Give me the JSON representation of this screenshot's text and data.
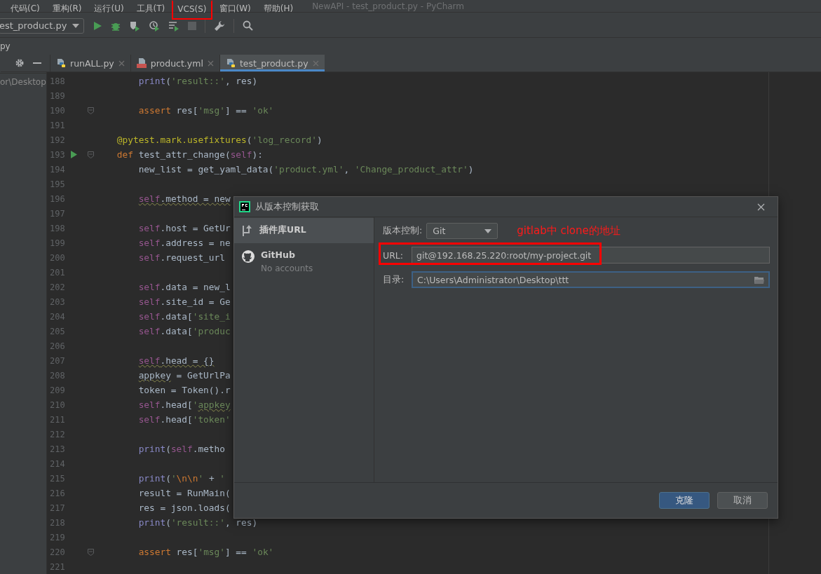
{
  "menu_bar": {
    "items": [
      {
        "label": "代码(C)",
        "highlighted": false
      },
      {
        "label": "重构(R)",
        "highlighted": false
      },
      {
        "label": "运行(U)",
        "highlighted": false
      },
      {
        "label": "工具(T)",
        "highlighted": false
      },
      {
        "label": "VCS(S)",
        "highlighted": true
      },
      {
        "label": "窗口(W)",
        "highlighted": false
      },
      {
        "label": "帮助(H)",
        "highlighted": false
      }
    ],
    "window_title": "NewAPI - test_product.py - PyCharm"
  },
  "toolbar": {
    "run_config": "est_product.py"
  },
  "breadcrumb": "py",
  "project_panel": {
    "path": "or\\Desktop"
  },
  "tabs": [
    {
      "label": "runALL.py",
      "kind": "python",
      "selected": false
    },
    {
      "label": "product.yml",
      "kind": "yaml",
      "selected": false
    },
    {
      "label": "test_product.py",
      "kind": "python",
      "selected": true
    }
  ],
  "editor": {
    "lines": [
      {
        "number": "188",
        "run_marker": false,
        "foldable": false,
        "tokens": [
          {
            "t": "        print",
            "kind": "builtin"
          },
          {
            "t": "(",
            "kind": "plain"
          },
          {
            "t": "'result::'",
            "kind": "string"
          },
          {
            "t": ", res)",
            "kind": "plain"
          }
        ]
      },
      {
        "number": "189",
        "run_marker": false,
        "foldable": false
      },
      {
        "number": "190",
        "run_marker": false,
        "foldable": true,
        "tokens": [
          {
            "t": "        assert",
            "kind": "keyword"
          },
          {
            "t": " res[",
            "kind": "plain"
          },
          {
            "t": "'msg'",
            "kind": "string"
          },
          {
            "t": "] == ",
            "kind": "plain"
          },
          {
            "t": "'ok'",
            "kind": "string"
          }
        ]
      },
      {
        "number": "191",
        "run_marker": false,
        "foldable": false
      },
      {
        "number": "192",
        "run_marker": false,
        "foldable": false,
        "tokens": [
          {
            "t": "    @pytest.mark.usefixtures",
            "kind": "decorator"
          },
          {
            "t": "(",
            "kind": "plain"
          },
          {
            "t": "'log_record'",
            "kind": "string"
          },
          {
            "t": ")",
            "kind": "plain"
          }
        ]
      },
      {
        "number": "193",
        "run_marker": true,
        "foldable": true,
        "tokens": [
          {
            "t": "    def",
            "kind": "keyword"
          },
          {
            "t": " test_attr_change(",
            "kind": "plain"
          },
          {
            "t": "self",
            "kind": "self"
          },
          {
            "t": "):",
            "kind": "plain"
          }
        ]
      },
      {
        "number": "194",
        "run_marker": false,
        "foldable": false,
        "tokens": [
          {
            "t": "        new_list = get_yaml_data(",
            "kind": "plain"
          },
          {
            "t": "'product.yml'",
            "kind": "string"
          },
          {
            "t": ", ",
            "kind": "plain"
          },
          {
            "t": "'Change_product_attr'",
            "kind": "string"
          },
          {
            "t": ")",
            "kind": "plain"
          }
        ]
      },
      {
        "number": "195",
        "run_marker": false,
        "foldable": false
      },
      {
        "number": "196",
        "run_marker": false,
        "foldable": false,
        "tokens": [
          {
            "t": "        self",
            "kind": "self",
            "squiggly": true
          },
          {
            "t": ".method = new",
            "kind": "plain",
            "squiggly": true
          }
        ]
      },
      {
        "number": "197",
        "run_marker": false,
        "foldable": false
      },
      {
        "number": "198",
        "run_marker": false,
        "foldable": false,
        "tokens": [
          {
            "t": "        self",
            "kind": "self"
          },
          {
            "t": ".host = GetUr",
            "kind": "plain"
          }
        ]
      },
      {
        "number": "199",
        "run_marker": false,
        "foldable": false,
        "tokens": [
          {
            "t": "        self",
            "kind": "self"
          },
          {
            "t": ".address = ne",
            "kind": "plain"
          }
        ]
      },
      {
        "number": "200",
        "run_marker": false,
        "foldable": false,
        "tokens": [
          {
            "t": "        self",
            "kind": "self"
          },
          {
            "t": ".request_url",
            "kind": "plain"
          }
        ]
      },
      {
        "number": "201",
        "run_marker": false,
        "foldable": false
      },
      {
        "number": "202",
        "run_marker": false,
        "foldable": false,
        "tokens": [
          {
            "t": "        self",
            "kind": "self"
          },
          {
            "t": ".data = new_l",
            "kind": "plain"
          }
        ]
      },
      {
        "number": "203",
        "run_marker": false,
        "foldable": false,
        "tokens": [
          {
            "t": "        self",
            "kind": "self"
          },
          {
            "t": ".site_id = Ge",
            "kind": "plain"
          }
        ]
      },
      {
        "number": "204",
        "run_marker": false,
        "foldable": false,
        "tokens": [
          {
            "t": "        self",
            "kind": "self"
          },
          {
            "t": ".data[",
            "kind": "plain"
          },
          {
            "t": "'site_i",
            "kind": "string"
          }
        ]
      },
      {
        "number": "205",
        "run_marker": false,
        "foldable": false,
        "tokens": [
          {
            "t": "        self",
            "kind": "self"
          },
          {
            "t": ".data[",
            "kind": "plain"
          },
          {
            "t": "'produc",
            "kind": "string"
          }
        ]
      },
      {
        "number": "206",
        "run_marker": false,
        "foldable": false
      },
      {
        "number": "207",
        "run_marker": false,
        "foldable": false,
        "tokens": [
          {
            "t": "        self",
            "kind": "self",
            "squiggly": true
          },
          {
            "t": ".head = {}",
            "kind": "plain",
            "squiggly": true
          }
        ]
      },
      {
        "number": "208",
        "run_marker": false,
        "foldable": false,
        "tokens": [
          {
            "t": "        appkey",
            "kind": "plain",
            "squiggly": true
          },
          {
            "t": " = GetUrlPa",
            "kind": "plain"
          }
        ]
      },
      {
        "number": "209",
        "run_marker": false,
        "foldable": false,
        "tokens": [
          {
            "t": "        token = Token().r",
            "kind": "plain"
          }
        ]
      },
      {
        "number": "210",
        "run_marker": false,
        "foldable": false,
        "tokens": [
          {
            "t": "        self",
            "kind": "self"
          },
          {
            "t": ".head[",
            "kind": "plain"
          },
          {
            "t": "'",
            "kind": "string"
          },
          {
            "t": "appkey",
            "kind": "string",
            "squiggly": true
          }
        ]
      },
      {
        "number": "211",
        "run_marker": false,
        "foldable": false,
        "tokens": [
          {
            "t": "        self",
            "kind": "self"
          },
          {
            "t": ".head[",
            "kind": "plain"
          },
          {
            "t": "'token'",
            "kind": "string"
          }
        ]
      },
      {
        "number": "212",
        "run_marker": false,
        "foldable": false
      },
      {
        "number": "213",
        "run_marker": false,
        "foldable": false,
        "tokens": [
          {
            "t": "        print",
            "kind": "builtin"
          },
          {
            "t": "(",
            "kind": "plain"
          },
          {
            "t": "self",
            "kind": "self"
          },
          {
            "t": ".metho",
            "kind": "plain"
          }
        ]
      },
      {
        "number": "214",
        "run_marker": false,
        "foldable": false
      },
      {
        "number": "215",
        "run_marker": false,
        "foldable": false,
        "tokens": [
          {
            "t": "        print",
            "kind": "builtin"
          },
          {
            "t": "(",
            "kind": "plain"
          },
          {
            "t": "'",
            "kind": "string"
          },
          {
            "t": "\\n\\n",
            "kind": "escape"
          },
          {
            "t": "'",
            "kind": "string"
          },
          {
            "t": " + ",
            "kind": "plain"
          },
          {
            "t": "'",
            "kind": "string"
          }
        ]
      },
      {
        "number": "216",
        "run_marker": false,
        "foldable": false,
        "tokens": [
          {
            "t": "        result = RunMain(",
            "kind": "plain"
          }
        ]
      },
      {
        "number": "217",
        "run_marker": false,
        "foldable": false,
        "tokens": [
          {
            "t": "        res = json.loads(",
            "kind": "plain"
          }
        ]
      },
      {
        "number": "218",
        "run_marker": false,
        "foldable": false,
        "tokens": [
          {
            "t": "        print",
            "kind": "builtin"
          },
          {
            "t": "(",
            "kind": "plain"
          },
          {
            "t": "'result::'",
            "kind": "string"
          },
          {
            "t": ", res)",
            "kind": "plain"
          }
        ]
      },
      {
        "number": "219",
        "run_marker": false,
        "foldable": false
      },
      {
        "number": "220",
        "run_marker": false,
        "foldable": true,
        "tokens": [
          {
            "t": "        assert",
            "kind": "keyword"
          },
          {
            "t": " res[",
            "kind": "plain"
          },
          {
            "t": "'msg'",
            "kind": "string"
          },
          {
            "t": "] == ",
            "kind": "plain"
          },
          {
            "t": "'ok'",
            "kind": "string"
          }
        ]
      },
      {
        "number": "221",
        "run_marker": false,
        "foldable": false
      }
    ]
  },
  "dialog": {
    "title": "从版本控制获取",
    "nav": [
      {
        "label": "插件库URL",
        "kind": "url",
        "selected": true
      },
      {
        "label": "GitHub",
        "sub": "No accounts",
        "kind": "github",
        "selected": false
      }
    ],
    "vcs_label": "版本控制:",
    "vcs_value": "Git",
    "annotation": "gitlab中 clone的地址",
    "url_label": "URL:",
    "url_value": "git@192.168.25.220:root/my-project.git",
    "url_highlighted": true,
    "dir_label": "目录:",
    "dir_value": "C:\\Users\\Administrator\\Desktop\\ttt",
    "buttons": [
      {
        "label": "克隆",
        "kind": "primary"
      },
      {
        "label": "取消",
        "kind": "secondary"
      }
    ]
  }
}
